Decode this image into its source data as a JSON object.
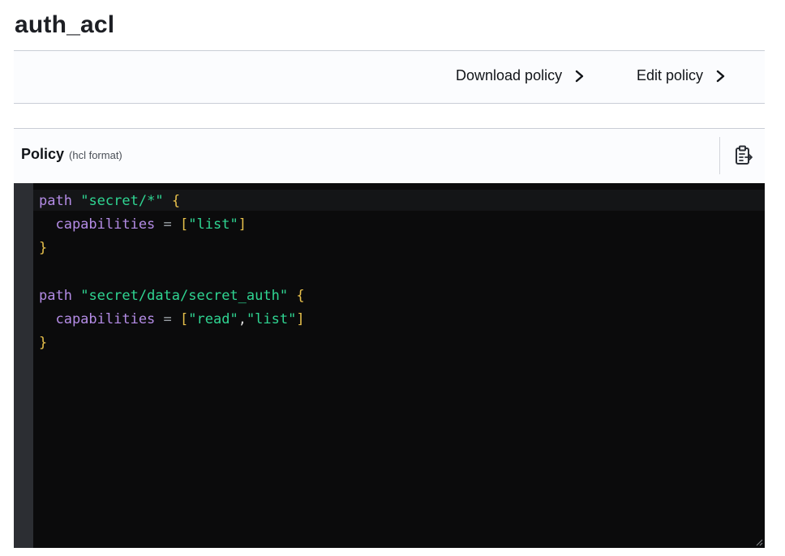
{
  "page": {
    "title": "auth_acl"
  },
  "toolbar": {
    "download_label": "Download policy",
    "edit_label": "Edit policy"
  },
  "policy": {
    "label": "Policy",
    "format": "(hcl format)",
    "copy_icon": "clipboard-copy-icon"
  },
  "code": {
    "lines": [
      [
        {
          "t": "path",
          "c": "kw"
        },
        {
          "t": " ",
          "c": "punct"
        },
        {
          "t": "\"secret/*\"",
          "c": "str"
        },
        {
          "t": " ",
          "c": "punct"
        },
        {
          "t": "{",
          "c": "brace"
        }
      ],
      [
        {
          "t": "  capabilities",
          "c": "prop"
        },
        {
          "t": " = ",
          "c": "op"
        },
        {
          "t": "[",
          "c": "brace"
        },
        {
          "t": "\"list\"",
          "c": "str"
        },
        {
          "t": "]",
          "c": "brace"
        }
      ],
      [
        {
          "t": "}",
          "c": "brace"
        }
      ],
      [],
      [
        {
          "t": "path",
          "c": "kw"
        },
        {
          "t": " ",
          "c": "punct"
        },
        {
          "t": "\"secret/data/secret_auth\"",
          "c": "str"
        },
        {
          "t": " ",
          "c": "punct"
        },
        {
          "t": "{",
          "c": "brace"
        }
      ],
      [
        {
          "t": "  capabilities",
          "c": "prop"
        },
        {
          "t": " = ",
          "c": "op"
        },
        {
          "t": "[",
          "c": "brace"
        },
        {
          "t": "\"read\"",
          "c": "str"
        },
        {
          "t": ",",
          "c": "punct"
        },
        {
          "t": "\"list\"",
          "c": "str"
        },
        {
          "t": "]",
          "c": "brace"
        }
      ],
      [
        {
          "t": "}",
          "c": "brace"
        }
      ]
    ]
  },
  "colors": {
    "editor_bg": "#0b0b0c",
    "gutter_bg": "#2c2e33",
    "keyword": "#b48ce6",
    "string": "#2fd592",
    "bracket": "#e7c04b"
  }
}
